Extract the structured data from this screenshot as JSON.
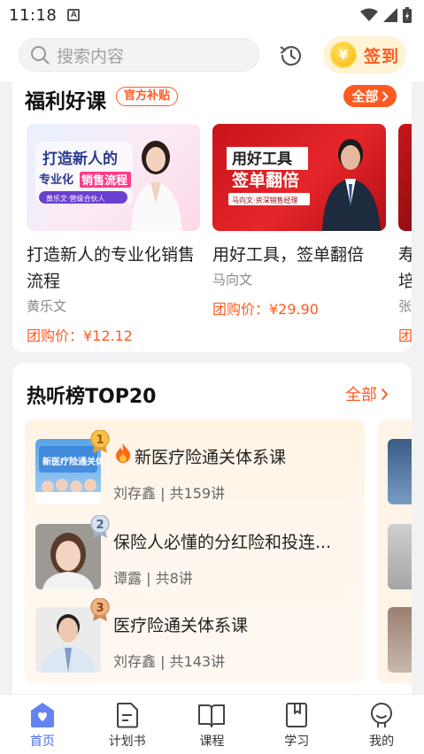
{
  "status_bar": {
    "time": "11:18",
    "notif_letter": "A"
  },
  "search": {
    "placeholder": "搜索内容"
  },
  "checkin": {
    "coin_symbol": "¥",
    "label": "签到"
  },
  "welfare": {
    "title": "福利好课",
    "tag": "官方补贴",
    "all_label": "全部",
    "courses": [
      {
        "title": "打造新人的专业化销售流程",
        "author": "黄乐文",
        "price": "团购价：¥12.12",
        "thumb_line1": "打造新人的",
        "thumb_line2_a": "专业化",
        "thumb_line2_b": "销售流程",
        "thumb_caption": "黄乐文·营级合伙人"
      },
      {
        "title": "用好工具，签单翻倍",
        "author": "马向文",
        "price": "团购价：¥29.90",
        "thumb_line1": "用好工具",
        "thumb_line2": "签单翻倍",
        "thumb_caption": "马向文·资深销售经理"
      },
      {
        "title": "寿培",
        "author": "张",
        "price": "团"
      }
    ]
  },
  "hot": {
    "title": "热听榜TOP20",
    "all_label": "全部",
    "items": [
      {
        "rank": "1",
        "title": "新医疗险通关体系课",
        "meta": "刘存鑫 | 共159讲",
        "cover_text": "新医疗险通关体系"
      },
      {
        "rank": "2",
        "title": "保险人必懂的分红险和投连...",
        "meta": "谭露 | 共8讲"
      },
      {
        "rank": "3",
        "title": "医疗险通关体系课",
        "meta": "刘存鑫 | 共143讲"
      }
    ]
  },
  "nav": {
    "items": [
      {
        "label": "首页"
      },
      {
        "label": "计划书"
      },
      {
        "label": "课程"
      },
      {
        "label": "学习"
      },
      {
        "label": "我的"
      }
    ],
    "active_color": "#4a6cf0"
  },
  "colors": {
    "accent": "#ff5a22",
    "nav_active": "#4a6cf0",
    "checkin_bg": "#fff3d6"
  }
}
